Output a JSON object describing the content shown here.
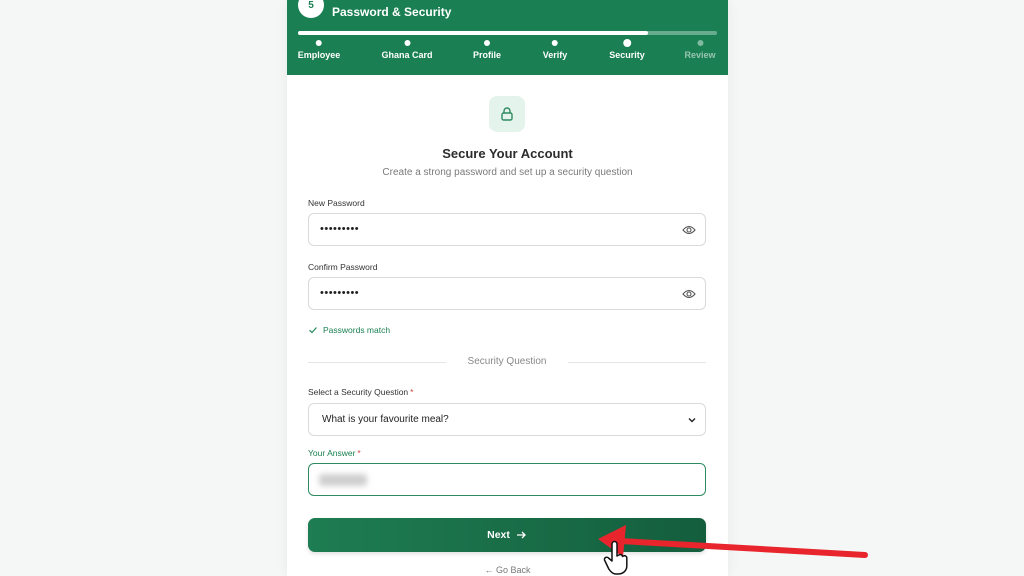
{
  "header": {
    "step_number": "5",
    "title": "Password & Security",
    "progress_fraction": 0.835,
    "steps": [
      {
        "label": "Employee",
        "state": "done"
      },
      {
        "label": "Ghana Card",
        "state": "done"
      },
      {
        "label": "Profile",
        "state": "done"
      },
      {
        "label": "Verify",
        "state": "done"
      },
      {
        "label": "Security",
        "state": "current"
      },
      {
        "label": "Review",
        "state": "upcoming"
      }
    ]
  },
  "main": {
    "icon": "lock-icon",
    "title": "Secure Your Account",
    "subtitle": "Create a strong password and set up a security question"
  },
  "form": {
    "new_password_label": "New Password",
    "new_password_value": "•••••••••",
    "confirm_password_label": "Confirm Password",
    "confirm_password_value": "•••••••••",
    "match_message": "Passwords match",
    "section_divider": "Security Question",
    "question_label": "Select a Security Question",
    "question_value": "What is your favourite meal?",
    "answer_label": "Your Answer",
    "required_mark": "*"
  },
  "actions": {
    "next_label": "Next",
    "back_label": "Go Back"
  },
  "colors": {
    "brand": "#1a7f52",
    "annotation_arrow": "#e8242c"
  }
}
